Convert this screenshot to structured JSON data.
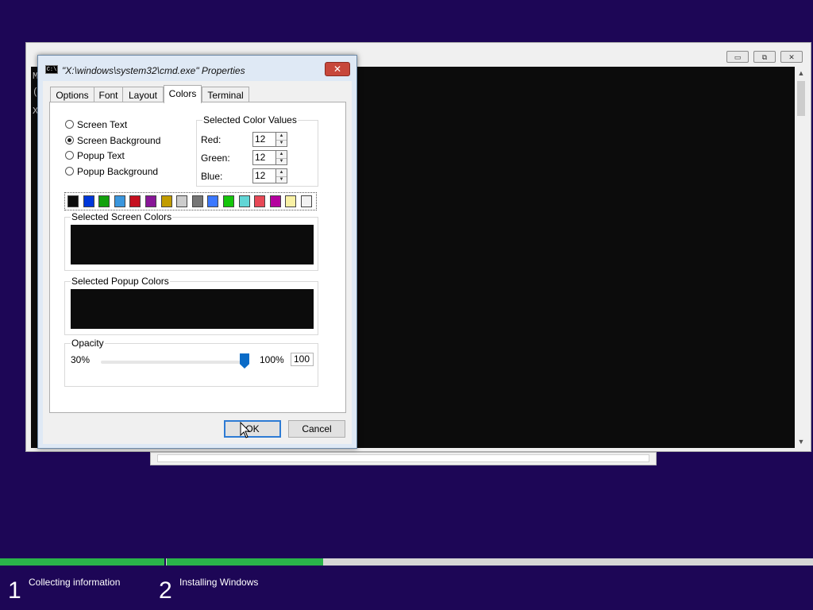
{
  "cmd_window": {
    "console_lines": [
      "M",
      "(",
      "",
      "X"
    ],
    "minimize_glyph": "▭",
    "restore_glyph": "⧉",
    "close_glyph": "✕",
    "scroll_up_glyph": "▲",
    "scroll_down_glyph": "▼"
  },
  "dialog": {
    "title": "\"X:\\windows\\system32\\cmd.exe\" Properties",
    "app_icon_text": "C:\\",
    "close_glyph": "✕",
    "tabs": [
      {
        "label": "Options"
      },
      {
        "label": "Font"
      },
      {
        "label": "Layout"
      },
      {
        "label": "Colors"
      },
      {
        "label": "Terminal"
      }
    ],
    "active_tab": "Colors",
    "radios": [
      {
        "label": "Screen Text",
        "checked": false
      },
      {
        "label": "Screen Background",
        "checked": true
      },
      {
        "label": "Popup Text",
        "checked": false
      },
      {
        "label": "Popup Background",
        "checked": false
      }
    ],
    "color_values": {
      "title": "Selected Color Values",
      "red_label": "Red:",
      "red_value": "12",
      "green_label": "Green:",
      "green_value": "12",
      "blue_label": "Blue:",
      "blue_value": "12"
    },
    "palette": [
      "#0c0c0c",
      "#0037da",
      "#13a10e",
      "#3a96dd",
      "#c50f1f",
      "#881798",
      "#c19c00",
      "#cccccc",
      "#767676",
      "#3b78ff",
      "#16c60c",
      "#61d6d6",
      "#e74856",
      "#b4009e",
      "#f9f1a5",
      "#f2f2f2"
    ],
    "screen_colors_title": "Selected Screen Colors",
    "popup_colors_title": "Selected Popup Colors",
    "preview_color": "#0c0c0c",
    "opacity": {
      "title": "Opacity",
      "min_label": "30%",
      "max_label": "100%",
      "value": "100"
    },
    "ok_label": "OK",
    "cancel_label": "Cancel"
  },
  "setup": {
    "steps": [
      {
        "number": "1",
        "label": "Collecting information"
      },
      {
        "number": "2",
        "label": "Installing Windows"
      }
    ],
    "progress_color": "#2ab44a"
  }
}
